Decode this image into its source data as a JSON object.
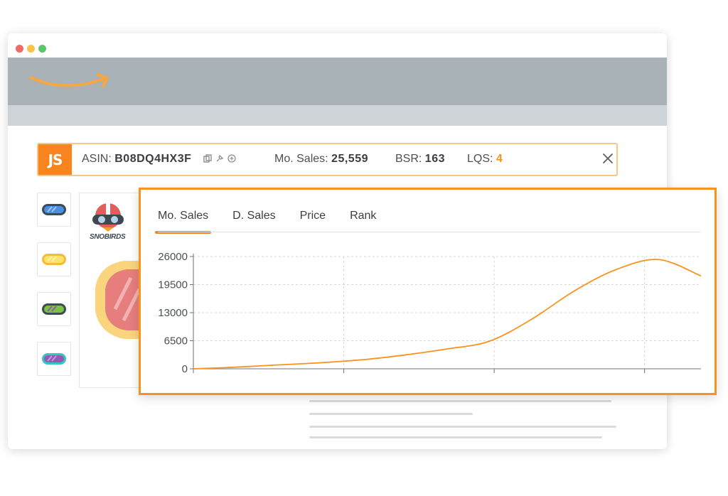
{
  "browser": {
    "controls": [
      "close-dot",
      "minimize-dot",
      "maximize-dot"
    ],
    "logo_icon": "amazon-smile-icon"
  },
  "js_bar": {
    "logo_text": "JS",
    "asin_label": "ASIN:",
    "asin_value": "B08DQ4HX3F",
    "action_icons": [
      "copy-icon",
      "pin-icon",
      "add-circle-icon"
    ],
    "sales_label": "Mo. Sales:",
    "sales_value": "25,559",
    "bsr_label": "BSR:",
    "bsr_value": "163",
    "lqs_label": "LQS:",
    "lqs_value": "4",
    "close_icon": "close-icon",
    "accent_color": "#f7931e"
  },
  "product": {
    "brand": "SNOBIRDS",
    "thumbnails": [
      {
        "icon": "goggles-blue-icon",
        "color": "#4a90e2"
      },
      {
        "icon": "goggles-yellow-icon",
        "color": "#f9d94a"
      },
      {
        "icon": "goggles-green-icon",
        "color": "#7bc142"
      },
      {
        "icon": "goggles-purple-icon",
        "color": "#8e5bb5"
      }
    ]
  },
  "chart_tabs": [
    {
      "label": "Mo. Sales",
      "active": true
    },
    {
      "label": "D. Sales",
      "active": false
    },
    {
      "label": "Price",
      "active": false
    },
    {
      "label": "Rank",
      "active": false
    }
  ],
  "chart_data": {
    "type": "line",
    "title": "",
    "xlabel": "",
    "ylabel": "",
    "ylim": [
      0,
      26000
    ],
    "y_ticks": [
      "26000",
      "19500",
      "13000",
      "6500",
      "0"
    ],
    "x_ticks": [
      "",
      "",
      ""
    ],
    "grid": true,
    "line_color": "#f7931e",
    "series": [
      {
        "x": [
          0,
          1,
          2,
          3,
          4,
          5,
          6,
          7,
          8,
          9,
          10,
          11,
          12
        ],
        "values": [
          0,
          380,
          900,
          1400,
          2100,
          3200,
          4600,
          6400,
          11500,
          18000,
          23000,
          25300,
          21500
        ]
      }
    ]
  }
}
